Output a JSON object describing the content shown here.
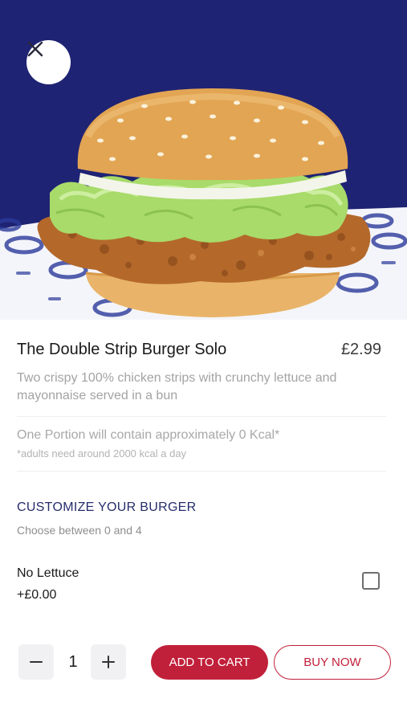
{
  "product": {
    "image_alt": "burger-photo",
    "name": "The Double Strip Burger Solo",
    "price": "£2.99",
    "description": "Two crispy 100% chicken strips with crunchy lettuce and mayonnaise served in a bun",
    "kcal": "One Portion will contain approximately 0 Kcal*",
    "kcal_note": "*adults need around 2000 kcal a day"
  },
  "customize": {
    "title": "CUSTOMIZE YOUR BURGER",
    "subtitle": "Choose between 0 and 4",
    "options": [
      {
        "name": "No Lettuce",
        "price": "+£0.00",
        "checked": false
      }
    ]
  },
  "cart": {
    "quantity": "1",
    "add_label": "ADD TO CART",
    "buy_label": "BUY NOW"
  },
  "icons": {
    "close": "close-icon",
    "minus": "minus-icon",
    "plus": "plus-icon"
  },
  "colors": {
    "hero_bg": "#1f2373",
    "accent": "#c1203a",
    "heading": "#262d6b"
  }
}
